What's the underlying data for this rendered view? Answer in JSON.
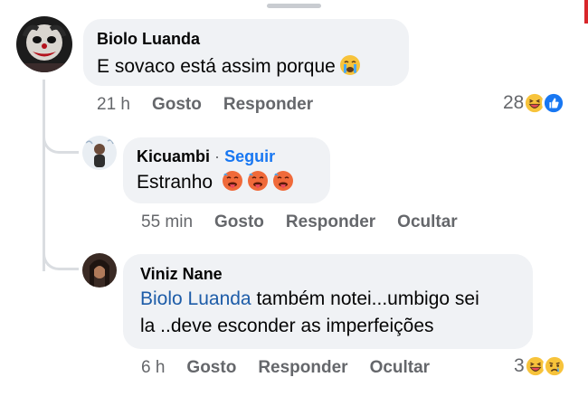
{
  "colors": {
    "bubble_bg": "#f0f2f5",
    "meta_text": "#65676b",
    "link_blue": "#1877f2",
    "thread_line": "#dadde1"
  },
  "comments": [
    {
      "author": "Biolo Luanda",
      "text": "E sovaco está assim porque",
      "text_emojis": [
        "crying-face-emoji"
      ],
      "time": "21 h",
      "like_label": "Gosto",
      "reply_label": "Responder",
      "reaction_count": "28",
      "reactions": [
        "laughing-face-emoji",
        "like-thumb-emoji"
      ]
    },
    {
      "author": "Kicuambi",
      "separator": "·",
      "follow_label": "Seguir",
      "text": "Estranho",
      "text_emojis": [
        "hot-face-emoji",
        "hot-face-emoji",
        "hot-face-emoji"
      ],
      "time": "55 min",
      "like_label": "Gosto",
      "reply_label": "Responder",
      "hide_label": "Ocultar"
    },
    {
      "author": "Viniz Nane",
      "mention": "Biolo Luanda",
      "text_line1": " também notei...umbigo sei",
      "text_line2": "la ..deve esconder as imperfeições",
      "time": "6 h",
      "like_label": "Gosto",
      "reply_label": "Responder",
      "hide_label": "Ocultar",
      "reaction_count": "3",
      "reactions": [
        "laughing-face-emoji",
        "sad-face-emoji"
      ]
    }
  ]
}
